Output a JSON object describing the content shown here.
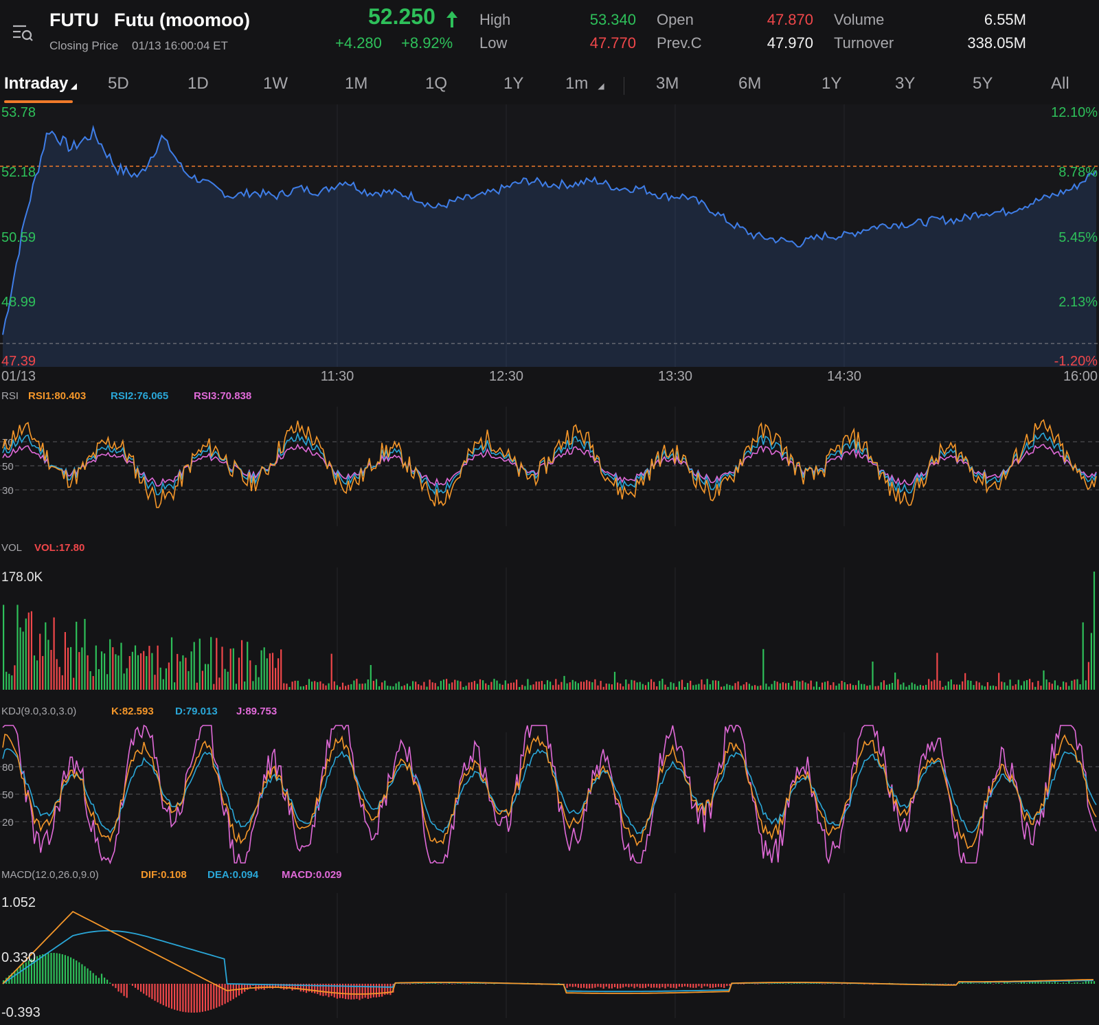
{
  "header": {
    "ticker": "FUTU",
    "name": "Futu (moomoo)",
    "status": "Closing Price",
    "timestamp": "01/13 16:00:04 ET",
    "price": "52.250",
    "change": "+4.280",
    "change_pct": "+8.92%",
    "high_label": "High",
    "high": "53.340",
    "low_label": "Low",
    "low": "47.770",
    "open_label": "Open",
    "open": "47.870",
    "prevc_label": "Prev.C",
    "prevc": "47.970",
    "volume_label": "Volume",
    "volume": "6.55M",
    "turnover_label": "Turnover",
    "turnover": "338.05M",
    "icons": {
      "menu": "menu-search-icon",
      "up_arrow": "up-arrow-icon"
    }
  },
  "tabs": [
    "Intraday",
    "5D",
    "1D",
    "1W",
    "1M",
    "1Q",
    "1Y",
    "1m",
    "3M",
    "6M",
    "1Y",
    "3Y",
    "5Y",
    "All"
  ],
  "active_tab": "Intraday",
  "colors": {
    "up": "#2ec05a",
    "down": "#f0474a",
    "price_line": "#3f7ee8",
    "orange": "#f5972a",
    "blue": "#2aa7d8",
    "pink": "#e06ad8",
    "accent": "#f07a2a"
  },
  "price_chart": {
    "y_left": [
      "53.78",
      "52.18",
      "50.59",
      "48.99",
      "47.39"
    ],
    "y_right": [
      "12.10%",
      "8.78%",
      "5.45%",
      "2.13%",
      "-1.20%"
    ],
    "x_labels": [
      "01/13",
      "11:30",
      "12:30",
      "13:30",
      "14:30",
      "16:00"
    ]
  },
  "rsi": {
    "title": "RSI",
    "rsi1": "RSI1:80.403",
    "rsi2": "RSI2:76.065",
    "rsi3": "RSI3:70.838",
    "levels": [
      "70",
      "50",
      "30"
    ]
  },
  "vol": {
    "title": "VOL",
    "value": "VOL:17.80",
    "max": "178.0K"
  },
  "kdj": {
    "title": "KDJ(9.0,3.0,3.0)",
    "k": "K:82.593",
    "d": "D:79.013",
    "j": "J:89.753",
    "levels": [
      "80",
      "50",
      "20"
    ]
  },
  "macd": {
    "title": "MACD(12.0,26.0,9.0)",
    "dif": "DIF:0.108",
    "dea": "DEA:0.094",
    "macd": "MACD:0.029",
    "levels": [
      "1.052",
      "0.330",
      "-0.393"
    ]
  },
  "chart_data": {
    "type": "line",
    "title": "",
    "x_start": "09:30",
    "x_end": "16:00",
    "xlabel": "",
    "ylabel": "",
    "ylim": [
      47.39,
      53.78
    ],
    "x": [
      "09:30",
      "09:35",
      "09:40",
      "09:45",
      "09:50",
      "09:55",
      "10:00",
      "10:05",
      "10:10",
      "10:15",
      "10:20",
      "10:25",
      "10:30",
      "10:35",
      "10:40",
      "10:45",
      "10:50",
      "10:55",
      "11:00",
      "11:10",
      "11:20",
      "11:30",
      "11:40",
      "11:50",
      "12:00",
      "12:10",
      "12:20",
      "12:30",
      "12:40",
      "12:50",
      "13:00",
      "13:10",
      "13:20",
      "13:30",
      "13:40",
      "13:50",
      "14:00",
      "14:10",
      "14:20",
      "14:30",
      "14:40",
      "14:50",
      "15:00",
      "15:10",
      "15:20",
      "15:30",
      "15:40",
      "15:50",
      "16:00"
    ],
    "series": [
      {
        "values": [
          48.1,
          51.1,
          53.3,
          52.8,
          53.2,
          52.3,
          52.1,
          53.1,
          52.2,
          51.9,
          51.6,
          51.7,
          51.6,
          51.8,
          51.7,
          52.0,
          51.7,
          51.7,
          51.6,
          51.3,
          51.5,
          51.6,
          51.8,
          52.0,
          51.9,
          51.9,
          52.0,
          51.8,
          51.8,
          51.6,
          51.6,
          51.3,
          50.9,
          50.6,
          50.5,
          50.4,
          50.6,
          50.6,
          50.8,
          50.9,
          50.9,
          51.0,
          51.0,
          51.2,
          51.2,
          51.4,
          51.6,
          51.8,
          52.25
        ]
      }
    ]
  }
}
